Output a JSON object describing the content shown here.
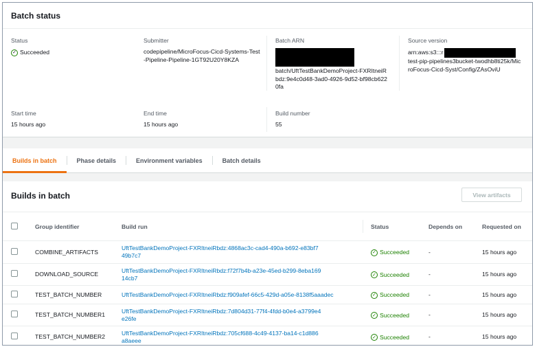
{
  "batch_status": {
    "title": "Batch status",
    "status_label": "Status",
    "status_value": "Succeeded",
    "submitter_label": "Submitter",
    "submitter_value": "codepipeline/MicroFocus-Cicd-Systems-Test-Pipeline-Pipeline-1GT92U20Y8KZA",
    "batch_arn_label": "Batch ARN",
    "batch_arn_value": "batch/UftTestBankDemoProject-FXRItneiRbdz:9e4c0d48-3ad0-4926-9d52-bf98cb6220fa",
    "source_version_label": "Source version",
    "source_version_prefix": "arn:aws:s3:::r",
    "source_version_value": "test-pip-pipelines3bucket-twodhb8ti25k/MicroFocus-Cicd-Syst/Config/ZAsOviU",
    "start_time_label": "Start time",
    "start_time_value": "15 hours ago",
    "end_time_label": "End time",
    "end_time_value": "15 hours ago",
    "build_number_label": "Build number",
    "build_number_value": "55"
  },
  "tabs": [
    {
      "label": "Builds in batch",
      "active": true
    },
    {
      "label": "Phase details",
      "active": false
    },
    {
      "label": "Environment variables",
      "active": false
    },
    {
      "label": "Batch details",
      "active": false
    }
  ],
  "builds": {
    "title": "Builds in batch",
    "view_artifacts_label": "View artifacts",
    "columns": {
      "group": "Group identifier",
      "build_run": "Build run",
      "status": "Status",
      "depends_on": "Depends on",
      "requested_on": "Requested on"
    },
    "rows": [
      {
        "group": "COMBINE_ARTIFACTS",
        "build_run": "UftTestBankDemoProject-FXRItneiRbdz:4868ac3c-cad4-490a-b692-e83bf749b7c7",
        "status": "Succeeded",
        "depends_on": "-",
        "requested_on": "15 hours ago"
      },
      {
        "group": "DOWNLOAD_SOURCE",
        "build_run": "UftTestBankDemoProject-FXRItneiRbdz:f72f7b4b-a23e-45ed-b299-8eba16914cb7",
        "status": "Succeeded",
        "depends_on": "-",
        "requested_on": "15 hours ago"
      },
      {
        "group": "TEST_BATCH_NUMBER",
        "build_run": "UftTestBankDemoProject-FXRItneiRbdz:f909afef-66c5-429d-a05e-8138f5aaadec",
        "status": "Succeeded",
        "depends_on": "-",
        "requested_on": "15 hours ago"
      },
      {
        "group": "TEST_BATCH_NUMBER1",
        "build_run": "UftTestBankDemoProject-FXRItneiRbdz:7d804d31-77f4-4fdd-b0e4-a3799e4e26fe",
        "status": "Succeeded",
        "depends_on": "-",
        "requested_on": "15 hours ago"
      },
      {
        "group": "TEST_BATCH_NUMBER2",
        "build_run": "UftTestBankDemoProject-FXRItneiRbdz:705cf688-4c49-4137-ba14-c1d886a8aeee",
        "status": "Succeeded",
        "depends_on": "-",
        "requested_on": "15 hours ago"
      }
    ]
  },
  "colors": {
    "success": "#1d8102",
    "link": "#0073bb",
    "active_tab": "#ec7211"
  }
}
